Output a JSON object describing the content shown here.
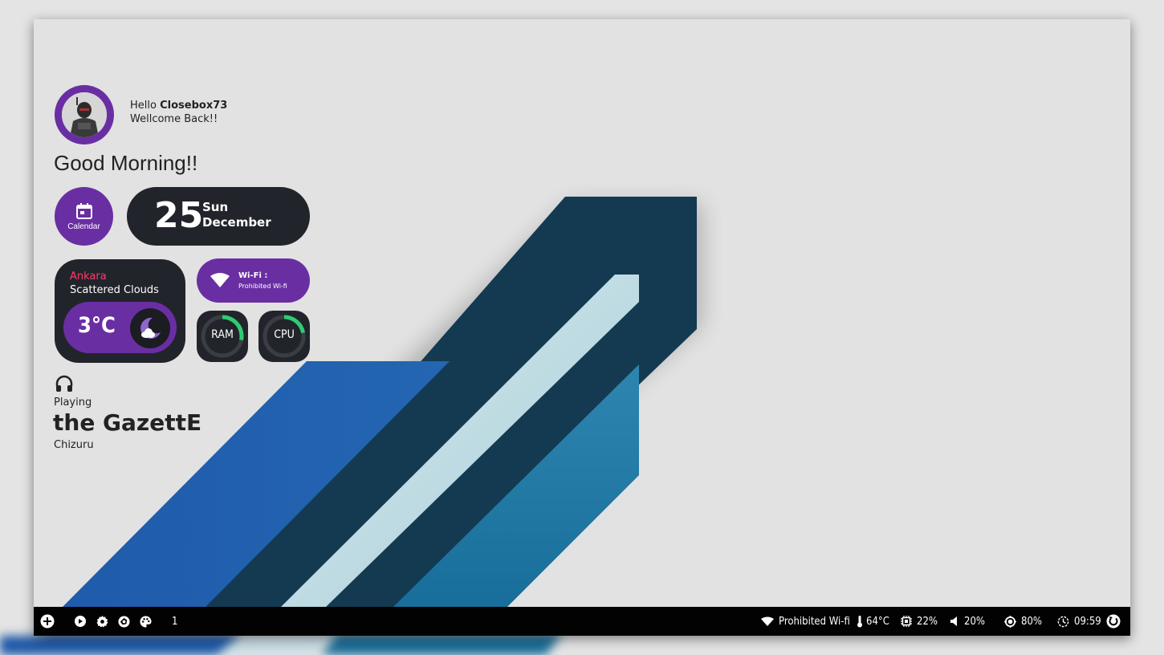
{
  "profile": {
    "hello": "Hello",
    "username": "Closebox73",
    "subtitle": "Wellcome Back!!"
  },
  "greeting": "Good Morning!!",
  "calendar": {
    "button_label": "Calendar",
    "day": "25",
    "weekday": "Sun",
    "month": "December"
  },
  "weather": {
    "city": "Ankara",
    "condition": "Scattered Clouds",
    "temperature": "3°C",
    "icon": "partly-cloudy-night-icon",
    "city_color": "#ff3b6b"
  },
  "wifi": {
    "title": "Wi-Fi :",
    "ssid": "Prohibited Wi-fi"
  },
  "system": {
    "ram_label": "RAM",
    "cpu_label": "CPU",
    "ram_fraction": 0.28,
    "cpu_fraction": 0.22
  },
  "music": {
    "status": "Playing",
    "artist": "the GazettE",
    "track": "Chizuru"
  },
  "taskbar": {
    "left_icons": [
      "add-icon",
      "play-icon",
      "settings-icon",
      "aperture-icon",
      "palette-icon"
    ],
    "workspace": "1",
    "wifi": "Prohibited Wi-fi",
    "temperature": "64°C",
    "cpu": "22%",
    "volume": "20%",
    "brightness": "80%",
    "clock": "09:59"
  },
  "colors": {
    "accent": "#6a2ea3",
    "card": "#22242b",
    "gauge_fill": "#2ecc71",
    "taskbar": "#020202"
  }
}
